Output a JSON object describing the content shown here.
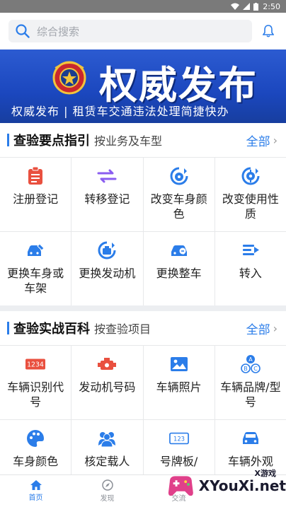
{
  "status": {
    "time": "2:50"
  },
  "search": {
    "placeholder": "综合搜索"
  },
  "banner": {
    "title": "权威发布",
    "subtitle": "权威发布 | 租赁车交通违法处理简捷快办"
  },
  "section1": {
    "title": "查验要点指引",
    "subtitle": "按业务及车型",
    "more": "全部",
    "items": [
      {
        "label": "注册登记",
        "icon": "clipboard-icon"
      },
      {
        "label": "转移登记",
        "icon": "transfer-arrows-icon"
      },
      {
        "label": "改变车身颜色",
        "icon": "palette-car-icon"
      },
      {
        "label": "改变使用性质",
        "icon": "gear-swap-icon"
      },
      {
        "label": "更换车身或车架",
        "icon": "car-wrench-icon"
      },
      {
        "label": "更换发动机",
        "icon": "engine-swap-icon"
      },
      {
        "label": "更换整车",
        "icon": "car-swap-icon"
      },
      {
        "label": "转入",
        "icon": "transfer-in-icon"
      }
    ]
  },
  "section2": {
    "title": "查验实战百科",
    "subtitle": "按查验项目",
    "more": "全部",
    "items": [
      {
        "label": "车辆识别代号",
        "icon": "vin-icon"
      },
      {
        "label": "发动机号码",
        "icon": "engine-icon"
      },
      {
        "label": "车辆照片",
        "icon": "photo-icon"
      },
      {
        "label": "车辆品牌/型号",
        "icon": "abc-icon"
      },
      {
        "label": "车身颜色",
        "icon": "palette-icon"
      },
      {
        "label": "核定载人",
        "icon": "people-icon"
      },
      {
        "label": "号牌板/",
        "icon": "plate-icon"
      },
      {
        "label": "车辆外观",
        "icon": "car-front-icon"
      }
    ]
  },
  "tabs": [
    {
      "label": "首页",
      "icon": "home-icon",
      "active": true
    },
    {
      "label": "发现",
      "icon": "compass-icon",
      "active": false
    },
    {
      "label": "交流",
      "icon": "chat-icon",
      "active": false
    }
  ],
  "watermark": {
    "text": "XYouXi.net",
    "small": "X游戏"
  },
  "colors": {
    "accent": "#2b7de9",
    "red": "#e9503f",
    "purple": "#8a5cf0",
    "blue": "#2b7de9"
  }
}
